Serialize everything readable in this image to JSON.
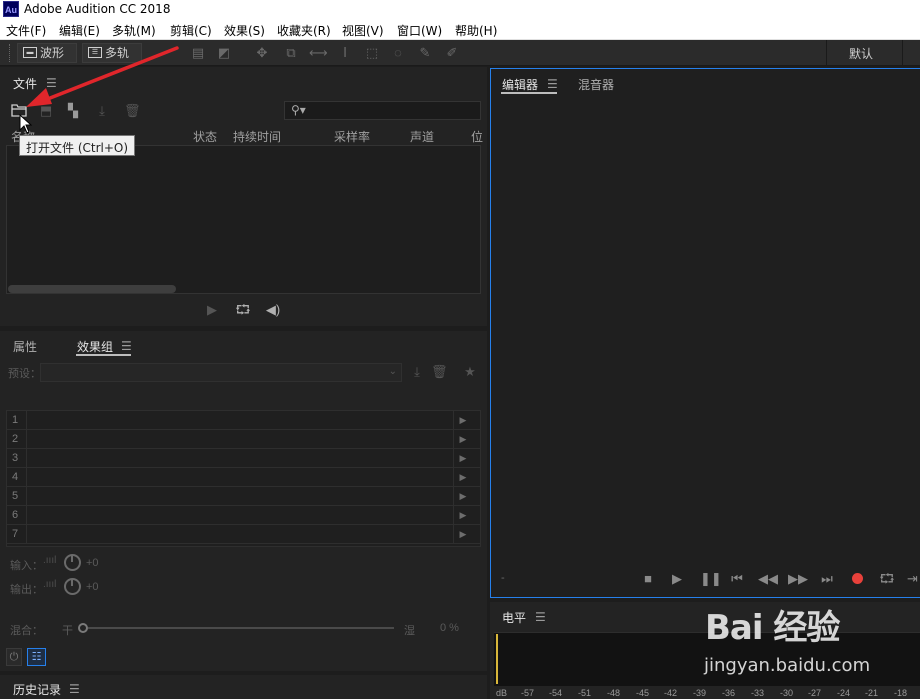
{
  "app": {
    "icon_text": "Au",
    "title": "Adobe Audition CC 2018"
  },
  "menu": [
    "文件(F)",
    "编辑(E)",
    "多轨(M)",
    "剪辑(C)",
    "效果(S)",
    "收藏夹(R)",
    "视图(V)",
    "窗口(W)",
    "帮助(H)"
  ],
  "toolbar": {
    "waveform_label": "波形",
    "multitrack_label": "多轨",
    "workspace_label": "默认"
  },
  "files_panel": {
    "title": "文件",
    "search_placeholder": "",
    "columns": [
      "名称",
      "状态",
      "持续时间",
      "采样率",
      "声道",
      "位"
    ],
    "tooltip": "打开文件 (Ctrl+O)"
  },
  "effects_panel": {
    "tab_properties": "属性",
    "tab_effects_rack": "效果组",
    "preset_label": "预设：",
    "rows": [
      "1",
      "2",
      "3",
      "4",
      "5",
      "6",
      "7"
    ],
    "input_label": "输入：",
    "input_value": "+0",
    "output_label": "输出：",
    "output_value": "+0",
    "mix_label": "混合：",
    "mix_dry": "干",
    "mix_wet": "湿",
    "mix_value": "0 %"
  },
  "history_panel": {
    "title": "历史记录"
  },
  "editor_panel": {
    "tab_editor": "编辑器",
    "tab_mixer": "混音器",
    "time_display": "-"
  },
  "levels_panel": {
    "title": "电平",
    "scale": [
      "dB",
      "-57",
      "-54",
      "-51",
      "-48",
      "-45",
      "-42",
      "-39",
      "-36",
      "-33",
      "-30",
      "-27",
      "-24",
      "-21",
      "-18"
    ]
  },
  "watermark": {
    "brand": "Bai 经验",
    "url": "jingyan.baidu.com"
  },
  "colors": {
    "accent": "#2680eb",
    "record": "#e8413b",
    "arrow": "#e0262b"
  }
}
